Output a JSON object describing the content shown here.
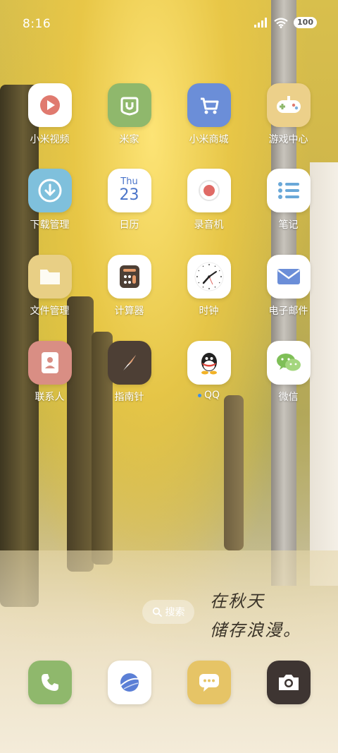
{
  "status_bar": {
    "time": "8:16",
    "battery": "100"
  },
  "apps": [
    {
      "label": "小米视频",
      "icon": "play-icon",
      "bg": "#ffffff"
    },
    {
      "label": "米家",
      "icon": "mijia-icon",
      "bg": "#8fb86c"
    },
    {
      "label": "小米商城",
      "icon": "cart-icon",
      "bg": "#6b8ed8"
    },
    {
      "label": "游戏中心",
      "icon": "gamepad-icon",
      "bg": "#ecd08a"
    },
    {
      "label": "下载管理",
      "icon": "download-icon",
      "bg": "#7fc0dc"
    },
    {
      "label": "日历",
      "icon": "calendar-icon",
      "bg": "#ffffff",
      "cal_day": "Thu",
      "cal_date": "23"
    },
    {
      "label": "录音机",
      "icon": "record-icon",
      "bg": "#ffffff"
    },
    {
      "label": "笔记",
      "icon": "notes-icon",
      "bg": "#ffffff"
    },
    {
      "label": "文件管理",
      "icon": "folder-icon",
      "bg": "#e8cf85"
    },
    {
      "label": "计算器",
      "icon": "calculator-icon",
      "bg": "#ffffff"
    },
    {
      "label": "时钟",
      "icon": "clock-icon",
      "bg": "#ffffff"
    },
    {
      "label": "电子邮件",
      "icon": "mail-icon",
      "bg": "#ffffff"
    },
    {
      "label": "联系人",
      "icon": "contacts-icon",
      "bg": "#d98e84"
    },
    {
      "label": "指南针",
      "icon": "compass-icon",
      "bg": "#4d3f35"
    },
    {
      "label": "QQ",
      "icon": "qq-icon",
      "bg": "#ffffff"
    },
    {
      "label": "微信",
      "icon": "wechat-icon",
      "bg": "#ffffff"
    }
  ],
  "search": {
    "label": "搜索"
  },
  "wallpaper_text": {
    "line1": "在秋天",
    "line2": "储存浪漫。"
  },
  "dock": [
    {
      "icon": "phone-icon",
      "bg": "#8fb86c"
    },
    {
      "icon": "browser-icon",
      "bg": "#ffffff"
    },
    {
      "icon": "messages-icon",
      "bg": "#e6c466"
    },
    {
      "icon": "camera-icon",
      "bg": "#3e3532"
    }
  ]
}
